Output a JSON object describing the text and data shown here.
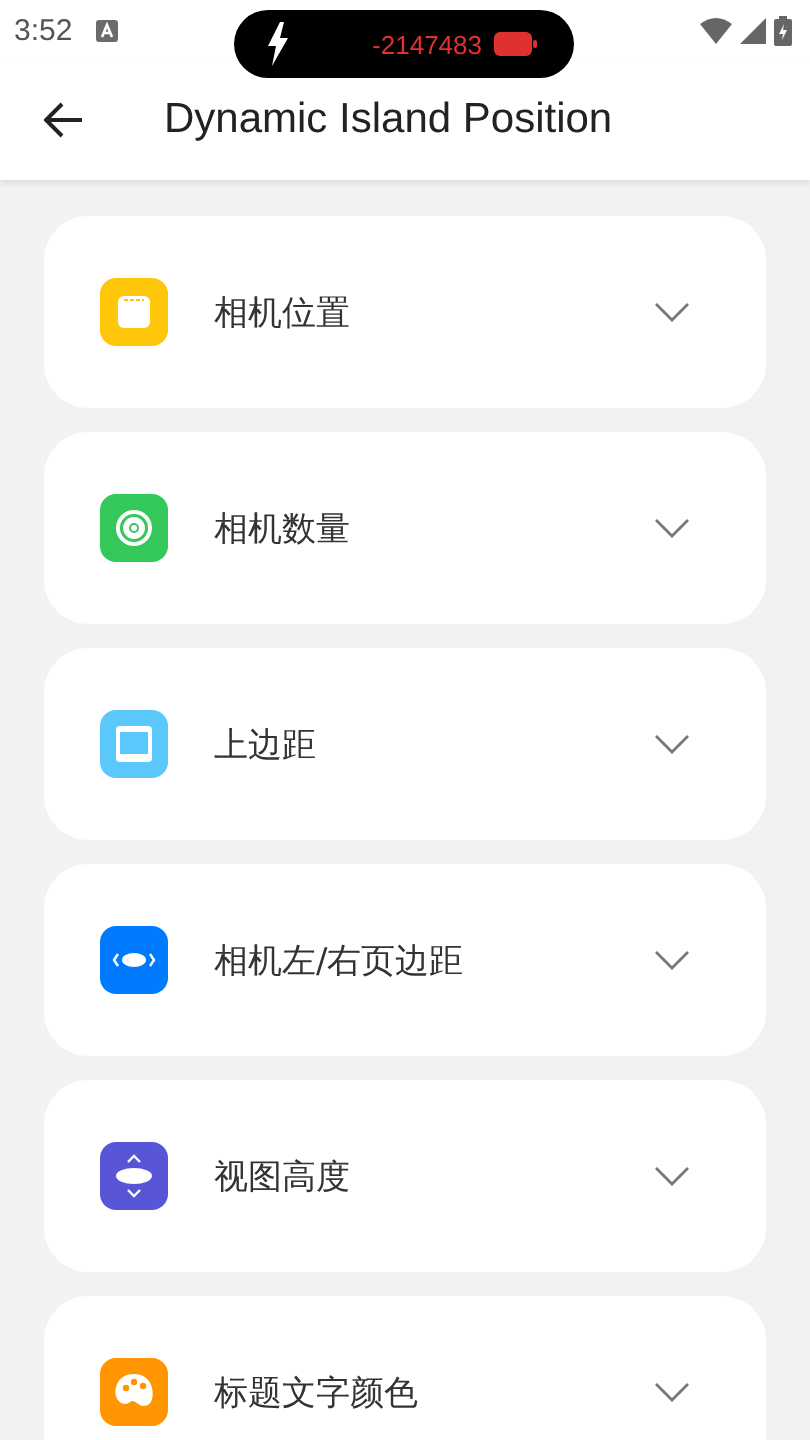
{
  "status_bar": {
    "time": "3:52"
  },
  "island": {
    "reading": "-2147483"
  },
  "app_bar": {
    "title": "Dynamic Island Position"
  },
  "settings": [
    {
      "label": "相机位置",
      "color": "#ffc60a",
      "expanded": false
    },
    {
      "label": "相机数量",
      "color": "#34c759",
      "expanded": false
    },
    {
      "label": "上边距",
      "color": "#5ac8fa",
      "expanded": false
    },
    {
      "label": "相机左/右页边距",
      "color": "#007aff",
      "expanded": false
    },
    {
      "label": "视图高度",
      "color": "#5856d6",
      "expanded": false
    },
    {
      "label": "标题文字颜色",
      "color": "#ff9500",
      "expanded": false
    }
  ]
}
